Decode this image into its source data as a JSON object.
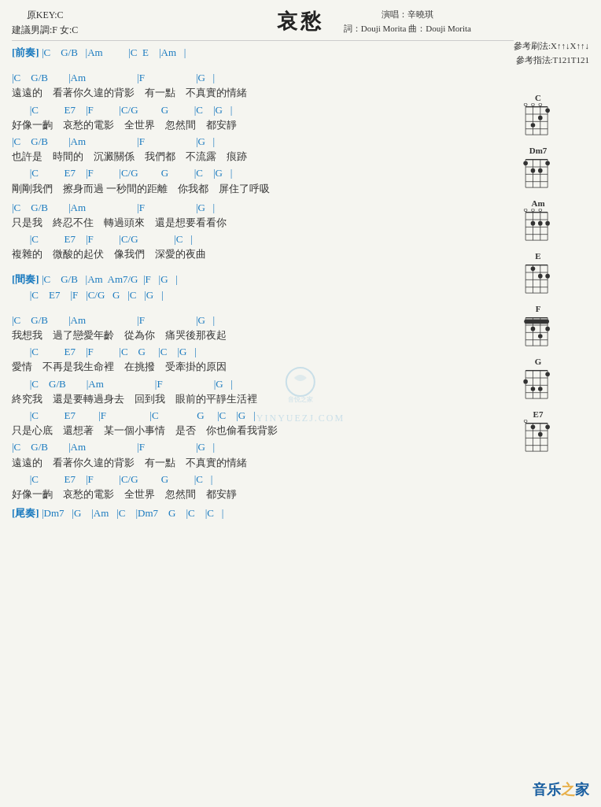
{
  "song": {
    "title": "哀愁",
    "original_key": "原KEY:C",
    "suggested_key": "建議男調:F 女:C",
    "performer": "演唱：辛曉琪",
    "composer": "詞：Douji Morita  曲：Douji Morita",
    "strumming_pattern": "參考刷法:X↑↑↓X↑↑↓",
    "fingering_pattern": "參考指法:T121T121"
  },
  "chords": [
    {
      "name": "C",
      "dots": [
        [
          1,
          2
        ],
        [
          2,
          3
        ],
        [
          3,
          4
        ]
      ]
    },
    {
      "name": "Dm7",
      "dots": [
        [
          1,
          1
        ],
        [
          2,
          2
        ],
        [
          3,
          2
        ],
        [
          4,
          2
        ]
      ]
    },
    {
      "name": "Am",
      "dots": [
        [
          1,
          0
        ],
        [
          2,
          1
        ],
        [
          3,
          2
        ]
      ]
    },
    {
      "name": "E",
      "dots": [
        [
          1,
          1
        ],
        [
          2,
          2
        ],
        [
          3,
          2
        ],
        [
          4,
          2
        ]
      ]
    },
    {
      "name": "F",
      "dots": [
        [
          1,
          1
        ],
        [
          2,
          1
        ],
        [
          3,
          2
        ],
        [
          4,
          3
        ]
      ]
    },
    {
      "name": "G",
      "dots": [
        [
          1,
          2
        ],
        [
          2,
          3
        ],
        [
          3,
          4
        ],
        [
          4,
          4
        ]
      ]
    },
    {
      "name": "E7",
      "dots": [
        [
          1,
          1
        ],
        [
          2,
          2
        ],
        [
          3,
          2
        ]
      ]
    }
  ],
  "sections": [
    {
      "label": "[前奏]",
      "lines": [
        {
          "type": "chord",
          "text": "|C    G/B   |Am          |C  E    |Am   |"
        }
      ]
    },
    {
      "label": "",
      "lines": [
        {
          "type": "chord",
          "text": "|C    G/B        |Am                    |F                    |G   |"
        },
        {
          "type": "lyric",
          "text": "遠遠的    看著你久違的背影    有一點    不真實的情緒"
        },
        {
          "type": "chord",
          "text": "       |C          E7    |F          |C/G         G          |C    |G   |"
        },
        {
          "type": "lyric",
          "text": "好像一齣    哀愁的電影    全世界    忽然間    都安靜"
        },
        {
          "type": "chord",
          "text": "|C    G/B        |Am                    |F                    |G   |"
        },
        {
          "type": "lyric",
          "text": "也許是    時間的    沉澱關係    我們都    不流露    痕跡"
        },
        {
          "type": "chord",
          "text": "       |C          E7    |F          |C/G         G          |C    |G   |"
        },
        {
          "type": "lyric",
          "text": "剛剛我們    擦身而過 一秒間的距離    你我都    屏住了呼吸"
        }
      ]
    },
    {
      "label": "",
      "lines": [
        {
          "type": "chord",
          "text": "|C    G/B        |Am                    |F                    |G   |"
        },
        {
          "type": "lyric",
          "text": "只是我    終忍不住    轉過頭來    還是想要看看你"
        },
        {
          "type": "chord",
          "text": "       |C          E7    |F          |C/G              |C   |"
        },
        {
          "type": "lyric",
          "text": "複雜的    微酸的起伏    像我們    深愛的夜曲"
        }
      ]
    },
    {
      "label": "[間奏]",
      "lines": [
        {
          "type": "chord",
          "text": "|C    G/B   |Am  Am7/G  |F   |G   |"
        },
        {
          "type": "chord",
          "text": "       |C    E7    |F   |C/G   G   |C   |G   |"
        }
      ]
    },
    {
      "label": "",
      "lines": [
        {
          "type": "chord",
          "text": "|C    G/B        |Am                    |F                    |G   |"
        },
        {
          "type": "lyric",
          "text": "我想我    過了戀愛年齡    從為你    痛哭後那夜起"
        },
        {
          "type": "chord",
          "text": "       |C          E7    |F          |C    G     |C    |G   |"
        },
        {
          "type": "lyric",
          "text": "愛情    不再是我生命裡    在挑撥    受牽掛的原因"
        },
        {
          "type": "chord",
          "text": "       |C    G/B        |Am                    |F                    |G   |"
        },
        {
          "type": "lyric",
          "text": "終究我    還是要轉過身去    回到我    眼前的平靜生活裡"
        },
        {
          "type": "chord",
          "text": "       |C          E7         |F                 |C               G     |C    |G   |"
        },
        {
          "type": "lyric",
          "text": "只是心底    還想著    某一個小事情    是否    你也偷看我背影"
        },
        {
          "type": "chord",
          "text": "|C    G/B        |Am                    |F                    |G   |"
        },
        {
          "type": "lyric",
          "text": "遠遠的    看著你久違的背影    有一點    不真實的情緒"
        },
        {
          "type": "chord",
          "text": "       |C          E7    |F          |C/G         G          |C   |"
        },
        {
          "type": "lyric",
          "text": "好像一齣    哀愁的電影    全世界    忽然間    都安靜"
        }
      ]
    },
    {
      "label": "[尾奏]",
      "lines": [
        {
          "type": "chord",
          "text": "|Dm7   |G    |Am   |C    |Dm7    G    |C    |C   |"
        }
      ]
    }
  ],
  "watermark": {
    "url_text": "YINYUEZJ.COM"
  },
  "footer": {
    "text": "音乐之家"
  }
}
